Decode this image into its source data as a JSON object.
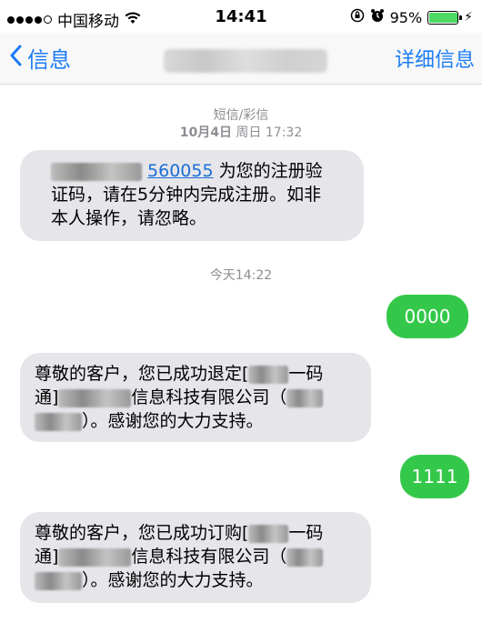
{
  "status_bar": {
    "carrier": "中国移动",
    "time": "14:41",
    "battery_percent": "95%",
    "battery_level": 0.95,
    "icons": [
      "signal-dots-icon",
      "wifi-icon",
      "lock-rotation-icon",
      "alarm-icon",
      "battery-icon",
      "charging-icon"
    ]
  },
  "nav": {
    "back_label": "信息",
    "details_label": "详细信息"
  },
  "thread": {
    "type_label": "短信/彩信",
    "date_bold": "10月4日",
    "date_rest": " 周日 17:32",
    "today_label": "今天14:22"
  },
  "messages": {
    "m1_code": "560055",
    "m1_line1_tail": " 为您的注册验",
    "m1_line2": "证码，请在5分钟内完成注册。如非",
    "m1_line3": "本人操作，请忽略。",
    "m2_text": "0000",
    "m3_line1_a": "尊敬的客户，您已成功退定[",
    "m3_line1_b": "一码",
    "m3_line2_a": "通]",
    "m3_line2_b": "信息科技有限公司（",
    "m3_line3_b": "）。感谢您的大力支持。",
    "m4_text": "1111",
    "m5_line1_a": "尊敬的客户，您已成功订购[",
    "m5_line1_b": "一码",
    "m5_line2_a": "通]",
    "m5_line2_b": "信息科技有限公司（",
    "m5_line3_b": "）。感谢您的大力支持。"
  },
  "colors": {
    "accent": "#1b7cf4",
    "incoming_bubble": "#e5e5ea",
    "outgoing_bubble": "#34c84a"
  }
}
